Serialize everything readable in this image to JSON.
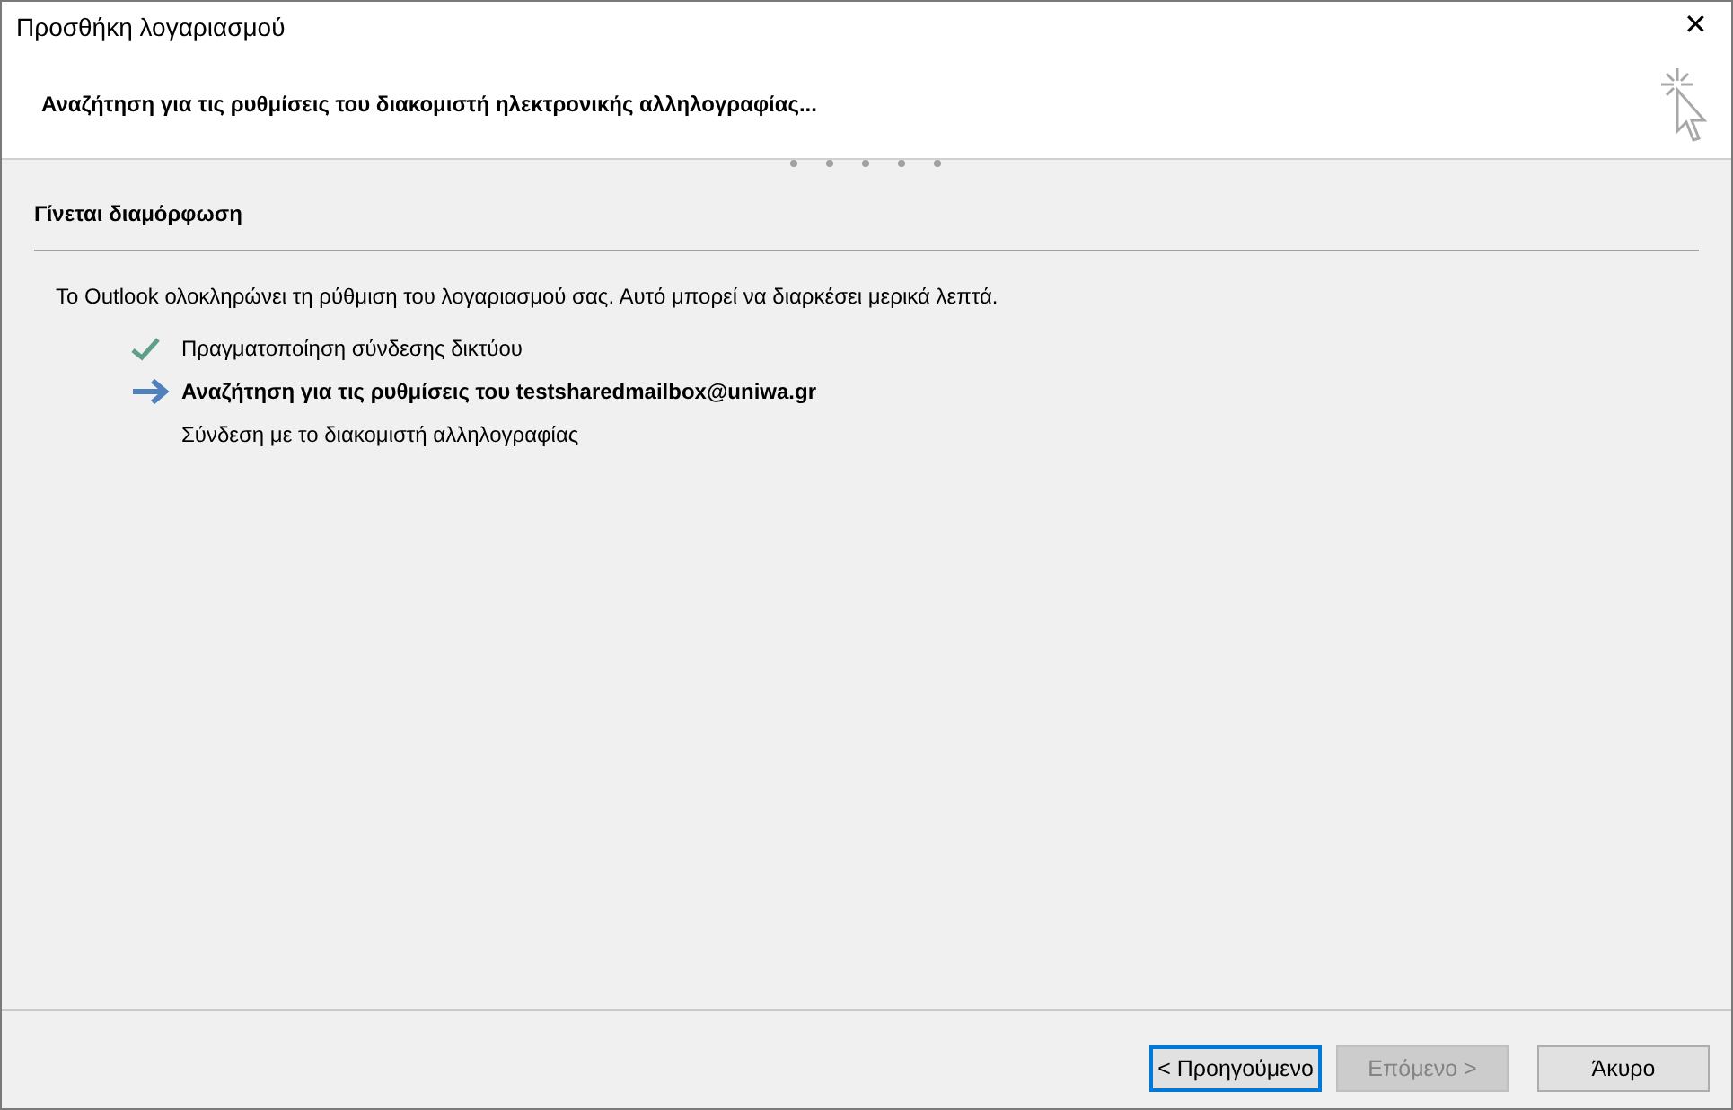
{
  "window": {
    "title": "Προσθήκη λογαριασμού",
    "close": "✕"
  },
  "header": {
    "title": "Αναζήτηση για τις ρυθμίσεις του διακομιστή ηλεκτρονικής αλληλογραφίας..."
  },
  "section": {
    "title": "Γίνεται διαμόρφωση",
    "intro": "Το Outlook ολοκληρώνει τη ρύθμιση του λογαριασμού σας. Αυτό μπορεί να διαρκέσει μερικά λεπτά."
  },
  "steps": [
    {
      "label": "Πραγματοποίηση σύνδεσης δικτύου",
      "kind": "done"
    },
    {
      "label": "Αναζήτηση για τις ρυθμίσεις του testsharedmailbox@uniwa.gr",
      "kind": "current"
    },
    {
      "label": "Σύνδεση με το διακομιστή αλληλογραφίας",
      "kind": "pending"
    }
  ],
  "buttons": [
    {
      "label": "< Προηγούμενο",
      "focused": true,
      "disabled": false
    },
    {
      "label": "Επόμενο >",
      "focused": false,
      "disabled": true
    },
    {
      "label": "Άκυρο",
      "focused": false,
      "disabled": false
    }
  ]
}
